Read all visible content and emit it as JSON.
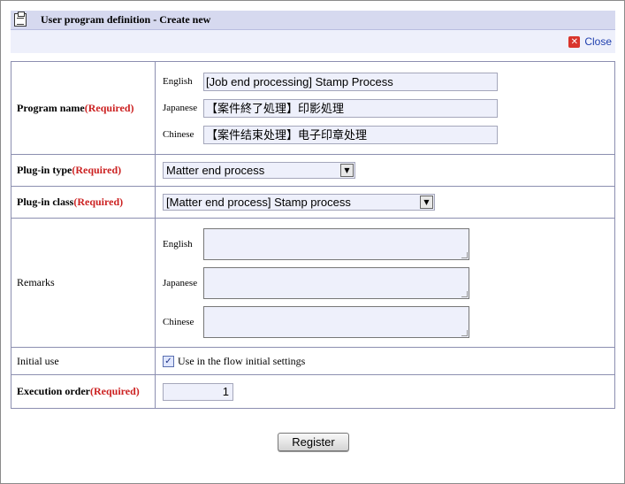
{
  "header": {
    "title": "User program definition - Create new",
    "icon": "clipboard-icon"
  },
  "close": {
    "label": "Close",
    "icon": "close-icon"
  },
  "form": {
    "program_name": {
      "label": "Program name",
      "required": "(Required)",
      "rows": [
        {
          "lang": "English",
          "value": "[Job end processing] Stamp Process"
        },
        {
          "lang": "Japanese",
          "value": "【案件終了処理】印影処理"
        },
        {
          "lang": "Chinese",
          "value": "【案件结束处理】电子印章处理"
        }
      ]
    },
    "plugin_type": {
      "label": "Plug-in type",
      "required": "(Required)",
      "value": "Matter end process"
    },
    "plugin_class": {
      "label": "Plug-in class",
      "required": "(Required)",
      "value": "[Matter end process] Stamp process"
    },
    "remarks": {
      "label": "Remarks",
      "rows": [
        {
          "lang": "English",
          "value": ""
        },
        {
          "lang": "Japanese",
          "value": ""
        },
        {
          "lang": "Chinese",
          "value": ""
        }
      ]
    },
    "initial_use": {
      "label": "Initial use",
      "checkbox_label": "Use in the flow initial settings",
      "checked": true
    },
    "execution_order": {
      "label": "Execution order",
      "required": "(Required)",
      "value": "1"
    }
  },
  "register": {
    "label": "Register"
  },
  "colors": {
    "required": "#cc2222",
    "header_bg": "#d6d9ef",
    "link": "#1f3fae",
    "input_bg": "#eef0fb"
  }
}
